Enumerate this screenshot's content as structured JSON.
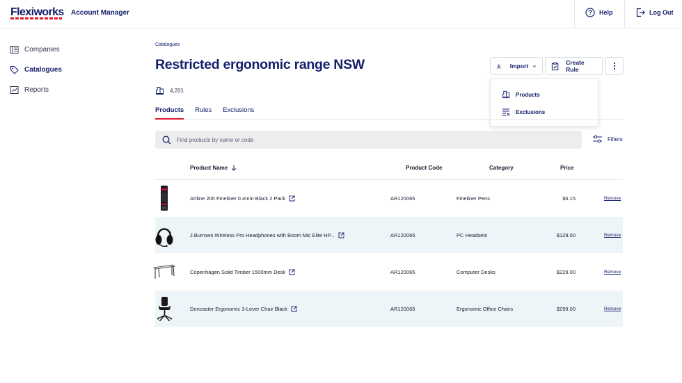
{
  "header": {
    "logo": "Flexiworks",
    "app_name": "Account Manager",
    "help_label": "Help",
    "logout_label": "Log Out"
  },
  "sidebar": {
    "items": [
      {
        "label": "Companies",
        "icon": "building-icon",
        "active": false
      },
      {
        "label": "Catalogues",
        "icon": "tag-icon",
        "active": true
      },
      {
        "label": "Reports",
        "icon": "chart-icon",
        "active": false
      }
    ]
  },
  "main": {
    "breadcrumb": "Catalogues",
    "title": "Restricted ergonomic range NSW",
    "product_count": "4,201",
    "actions": {
      "import_label": "Import",
      "create_rule_label": "Create Rule"
    },
    "import_menu": [
      {
        "label": "Products",
        "icon": "products-icon"
      },
      {
        "label": "Exclusions",
        "icon": "exclusions-icon"
      }
    ],
    "tabs": [
      {
        "label": "Products",
        "active": true
      },
      {
        "label": "Rules",
        "active": false
      },
      {
        "label": "Exclusions",
        "active": false
      }
    ],
    "search": {
      "placeholder": "Find products by name or code"
    },
    "filters_label": "Filters",
    "table": {
      "columns": [
        "Product Name",
        "Product Code",
        "Category",
        "Price"
      ],
      "remove_label": "Remove",
      "rows": [
        {
          "name": "Artline 200 Fineliner 0.4mm Black 2 Pack",
          "code": "AR120065",
          "category": "Fineliner Pens",
          "price": "$6.15",
          "thumb": "pen-pack"
        },
        {
          "name": "J.Burrows Wireless Pro Headphones with Boom Mic Elite HP...",
          "code": "AR120065",
          "category": "PC Headsets",
          "price": "$129.00",
          "thumb": "headset"
        },
        {
          "name": "Copenhagen Solid Timber 1500mm Desk",
          "code": "AR120065",
          "category": "Computer Desks",
          "price": "$229.00",
          "thumb": "desk"
        },
        {
          "name": "Doncaster Ergonomic 3-Lever Chair Black",
          "code": "AR120065",
          "category": "Ergonomic Office Chairs",
          "price": "$299.00",
          "thumb": "chair"
        }
      ]
    }
  },
  "colors": {
    "brand_navy": "#15206b",
    "accent_red": "#e0192f",
    "row_shade": "#eef5f9",
    "search_bg": "#ededf0"
  }
}
